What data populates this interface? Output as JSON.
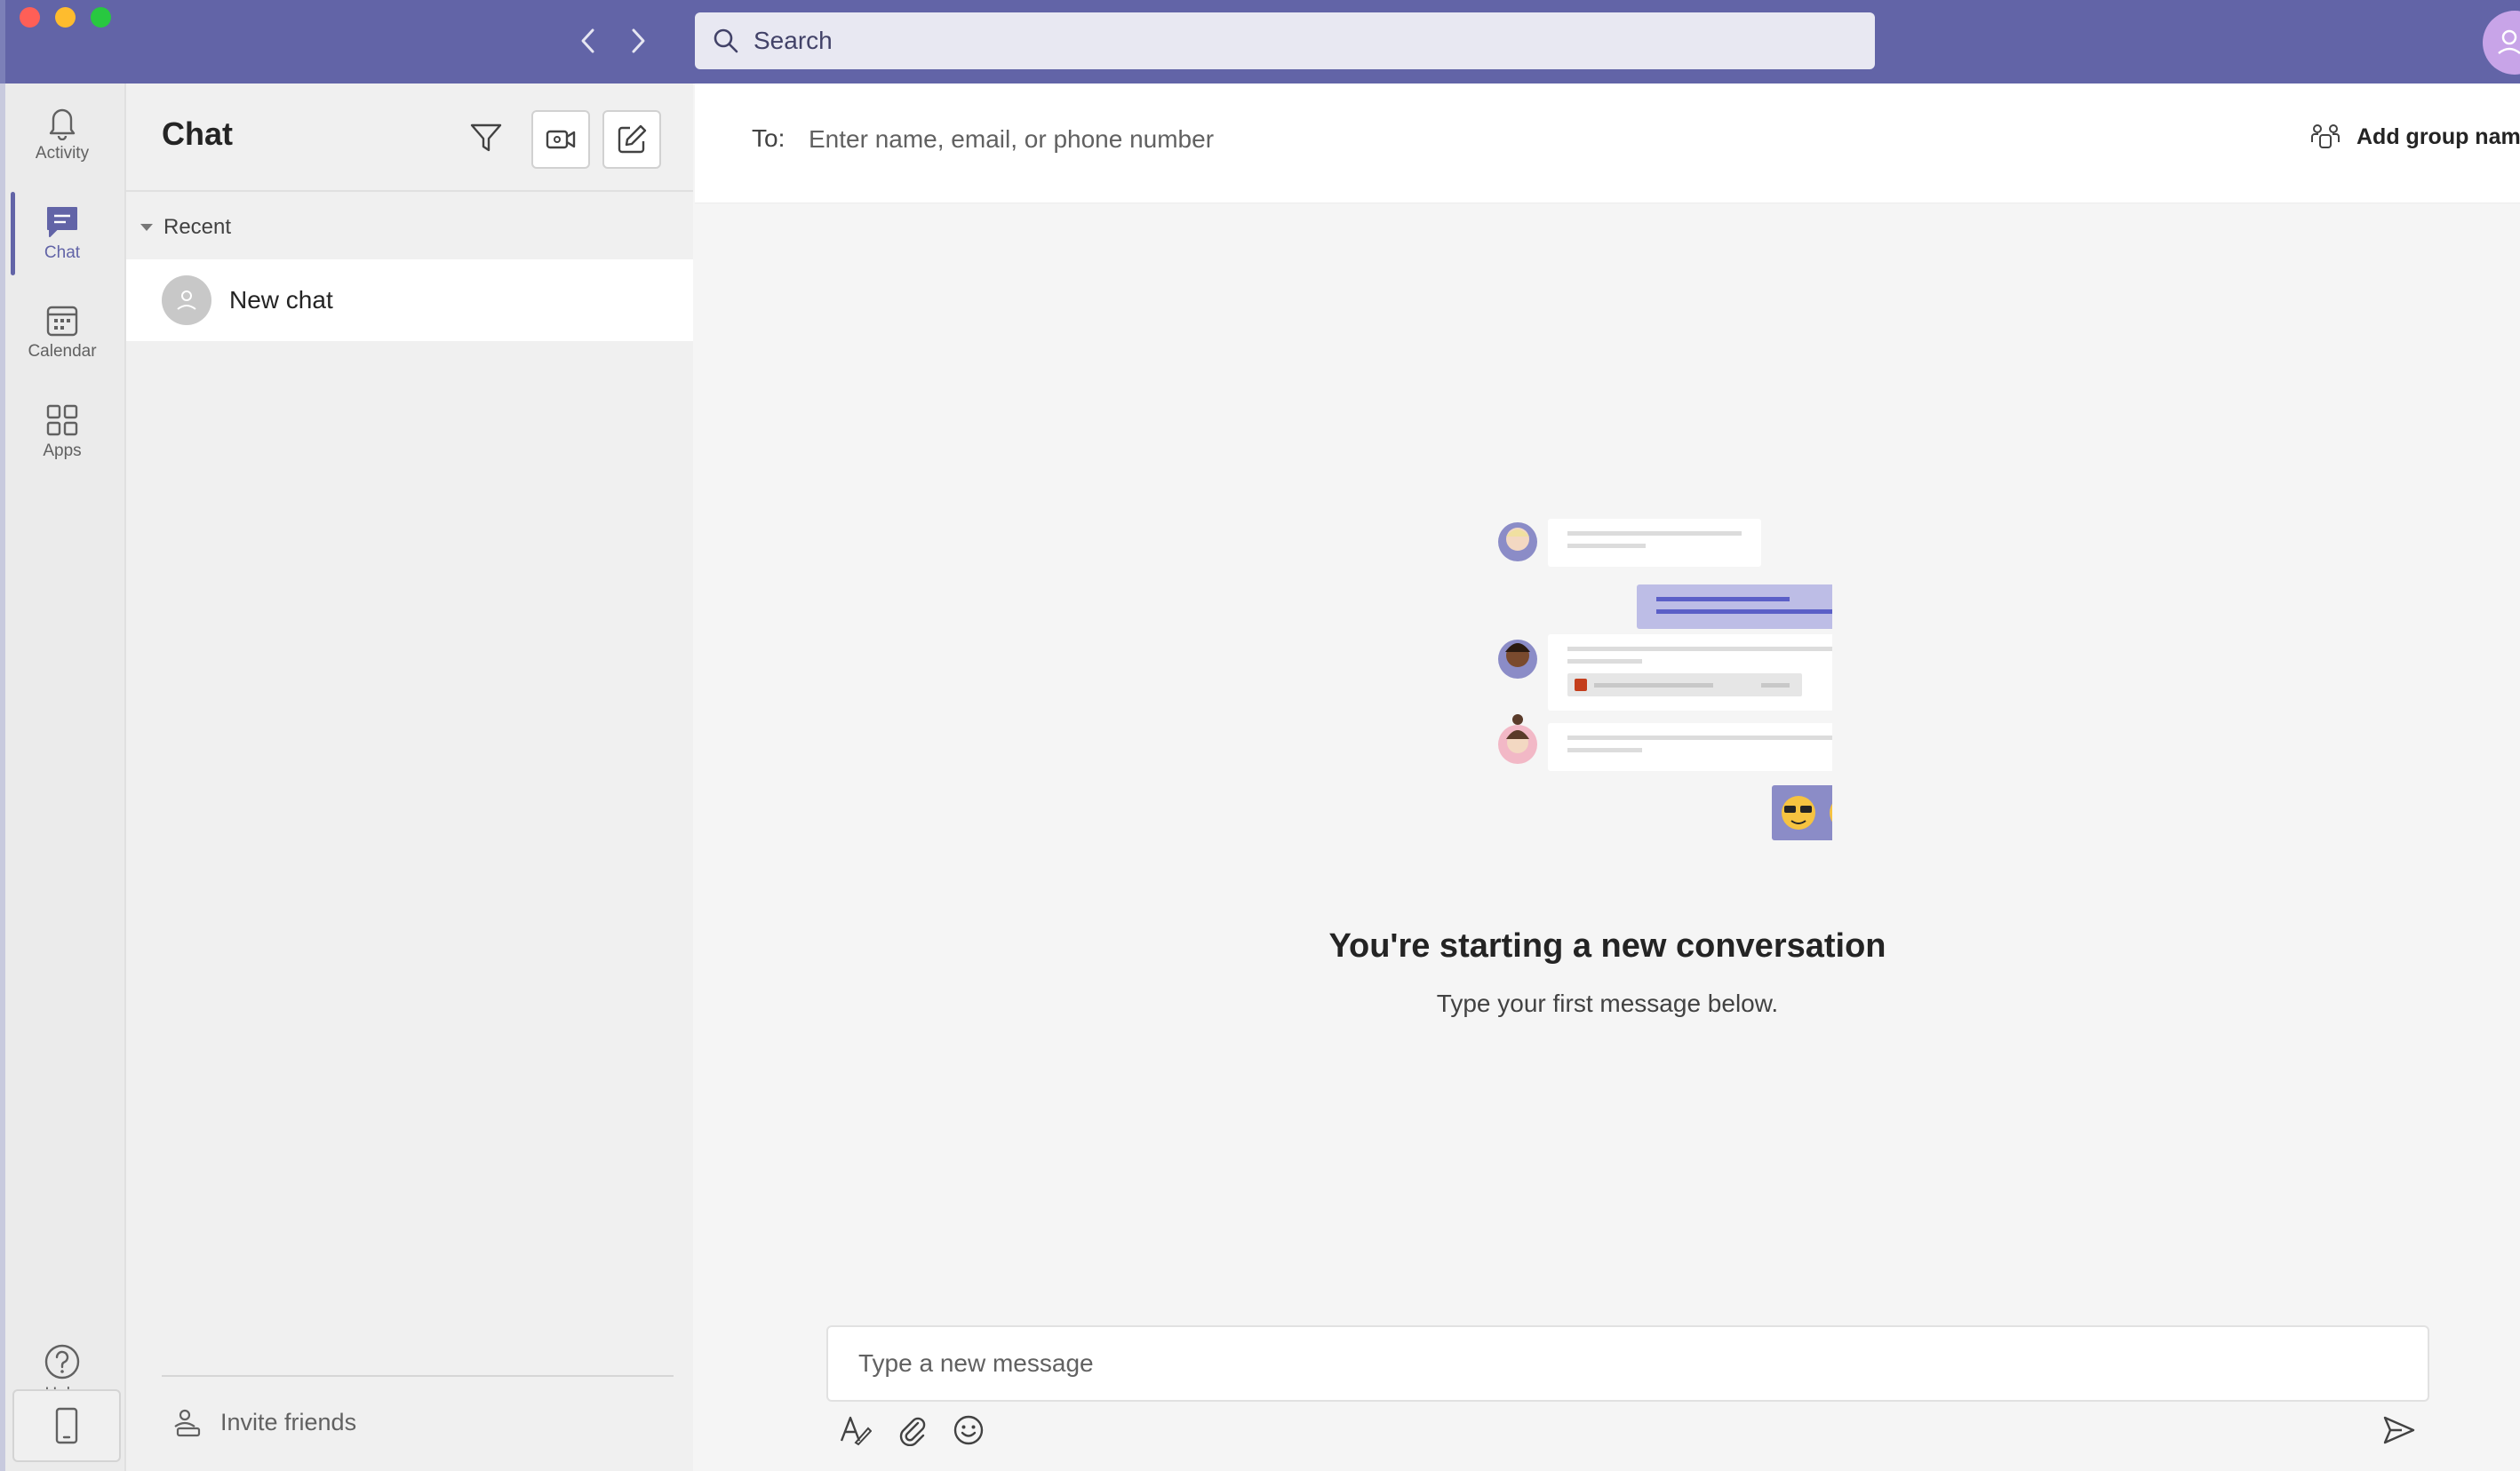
{
  "titlebar": {
    "search": {
      "placeholder": "Search"
    }
  },
  "rail": {
    "items": [
      {
        "label": "Activity",
        "icon": "bell-icon"
      },
      {
        "label": "Chat",
        "icon": "chat-icon",
        "active": true
      },
      {
        "label": "Calendar",
        "icon": "calendar-icon"
      },
      {
        "label": "Apps",
        "icon": "apps-icon"
      }
    ],
    "help": {
      "label": "Help",
      "icon": "help-icon"
    }
  },
  "chat_pane": {
    "title": "Chat",
    "section": "Recent",
    "items": [
      {
        "label": "New chat"
      }
    ],
    "invite": "Invite friends"
  },
  "main": {
    "to_label": "To:",
    "to_placeholder": "Enter name, email, or phone number",
    "add_group": "Add group name",
    "empty_title": "You're starting a new conversation",
    "empty_subtitle": "Type your first message below.",
    "composer_placeholder": "Type a new message"
  },
  "colors": {
    "brand": "#6264a7",
    "titlebar": "#6264a7",
    "rail_bg": "#ebebeb",
    "pane_bg": "#f0f0f0",
    "main_bg": "#f5f5f5"
  }
}
